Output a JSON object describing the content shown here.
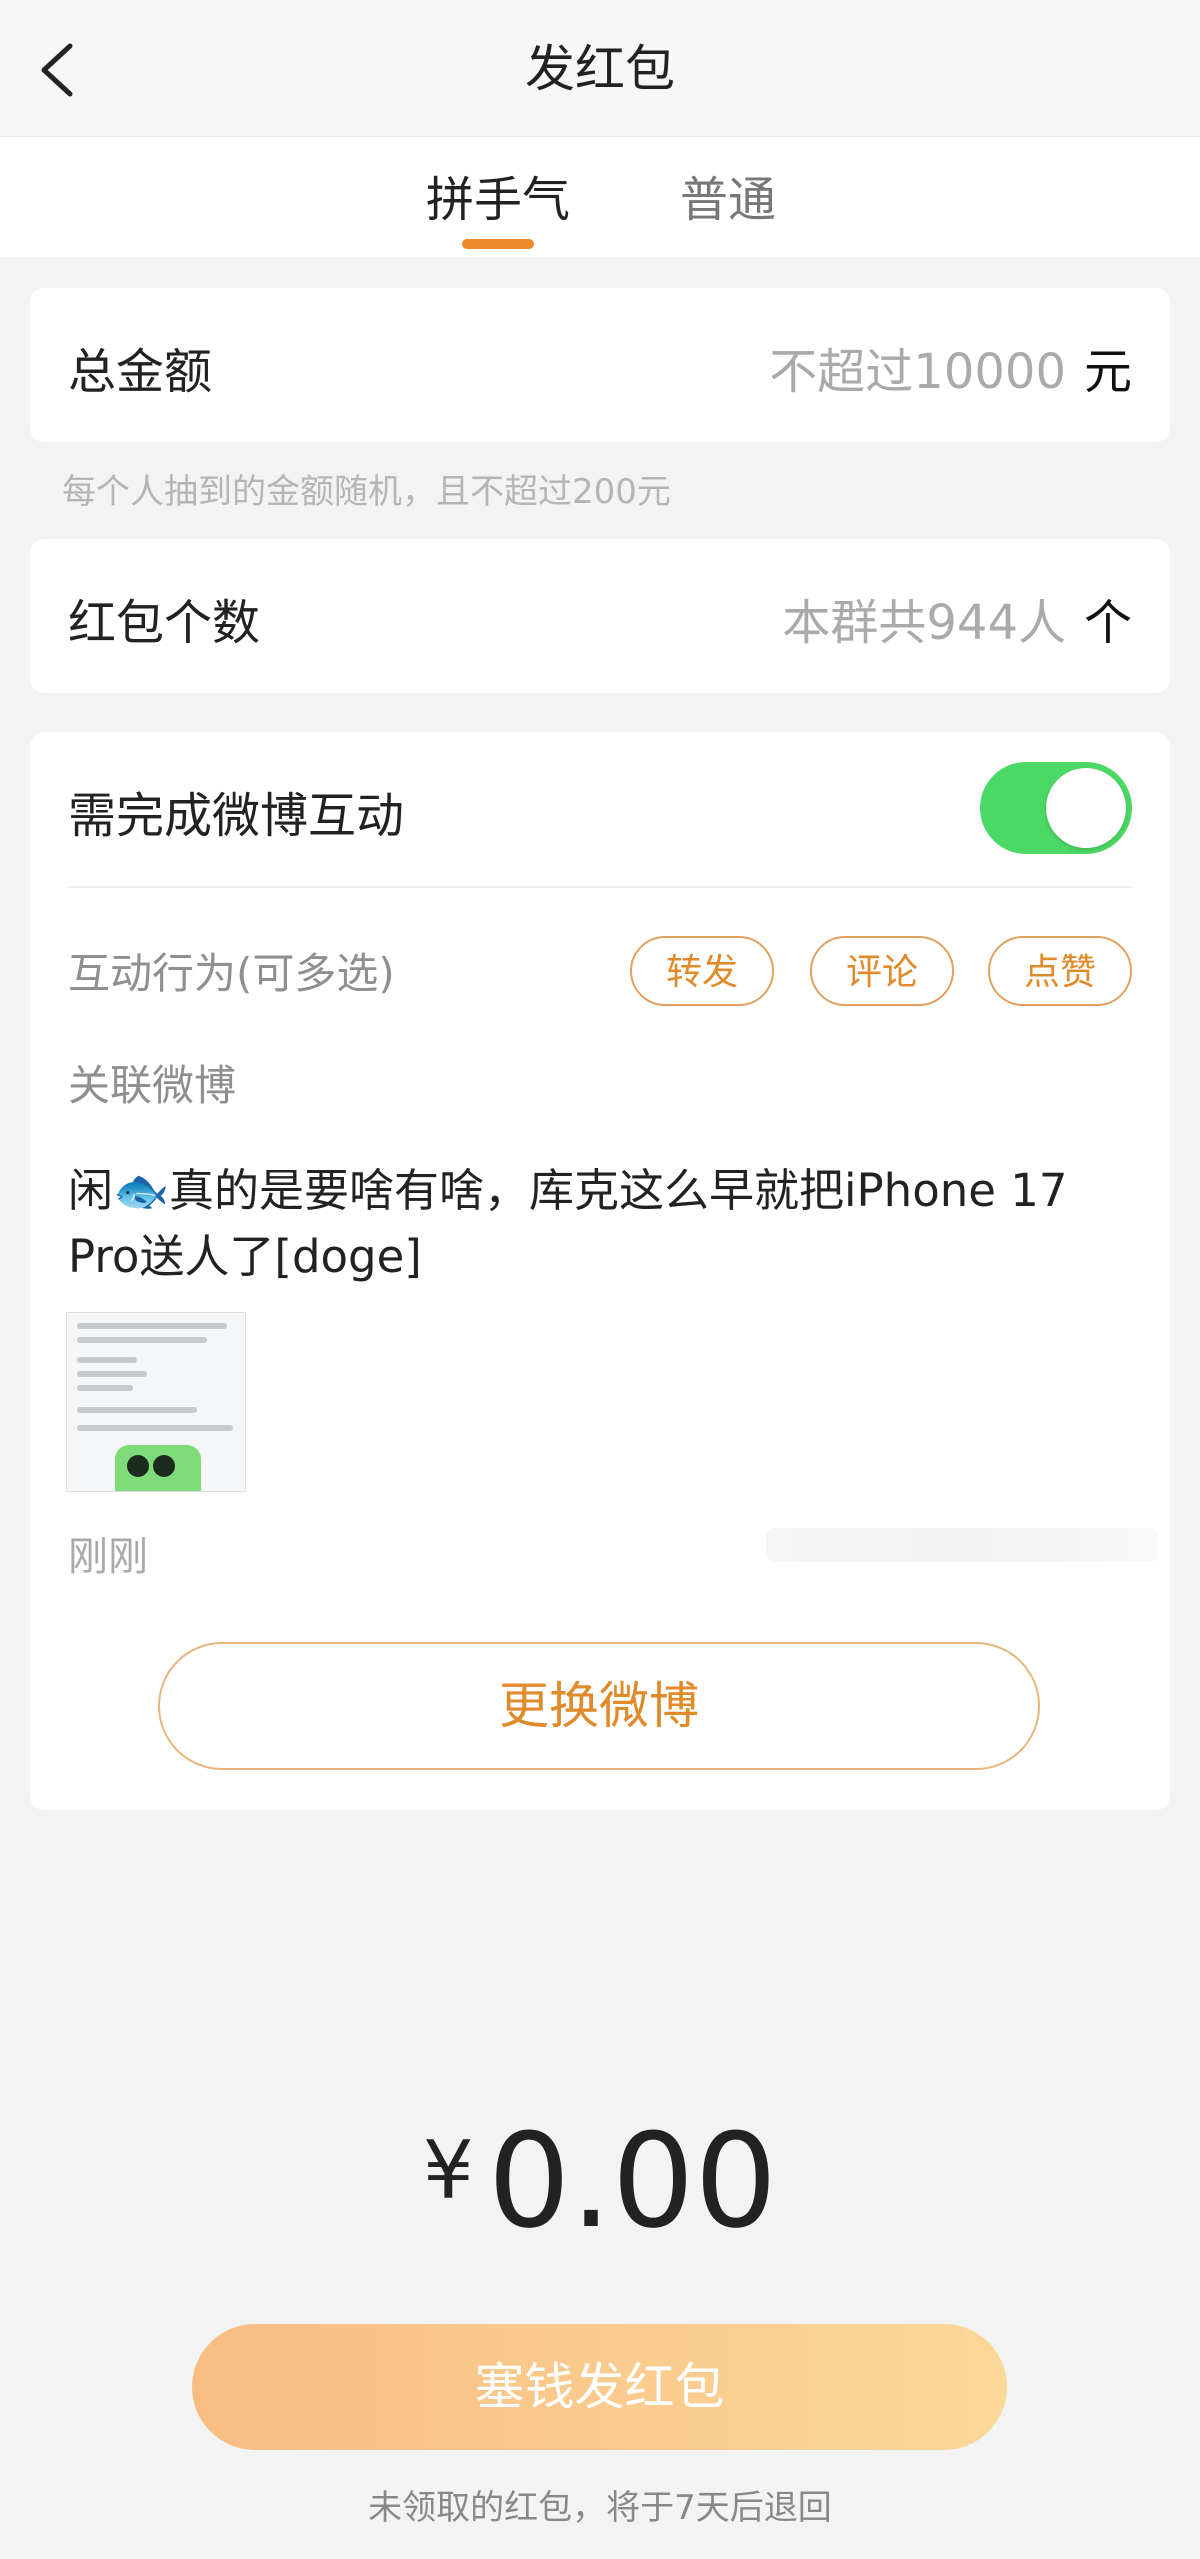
{
  "header": {
    "title": "发红包",
    "back_icon": "chevron-left-icon"
  },
  "tabs": [
    {
      "label": "拼手气",
      "active": true
    },
    {
      "label": "普通",
      "active": false
    }
  ],
  "colors": {
    "accent": "#f0892b",
    "toggle_on": "#4cd864",
    "button_gradient_start": "#f9bd83",
    "button_gradient_end": "#fad897"
  },
  "total_amount": {
    "label": "总金额",
    "placeholder": "不超过10000",
    "unit": "元",
    "hint": "每个人抽到的金额随机，且不超过200元"
  },
  "count": {
    "label": "红包个数",
    "placeholder": "本群共944人",
    "unit": "个"
  },
  "interaction": {
    "label": "需完成微博互动",
    "toggle_on": true,
    "actions_label": "互动行为(可多选)",
    "actions": [
      "转发",
      "评论",
      "点赞"
    ],
    "related_label": "关联微博",
    "post_text_before": "闲",
    "post_text_emoji": "🐟",
    "post_text_after": "真的是要啥有啥，库克这么早就把iPhone 17 Pro送人了[doge]",
    "post_time": "刚刚",
    "change_button": "更换微博"
  },
  "amount_display": {
    "currency": "¥",
    "value": "0.00"
  },
  "send_button": "塞钱发红包",
  "footer_note": "未领取的红包，将于7天后退回"
}
